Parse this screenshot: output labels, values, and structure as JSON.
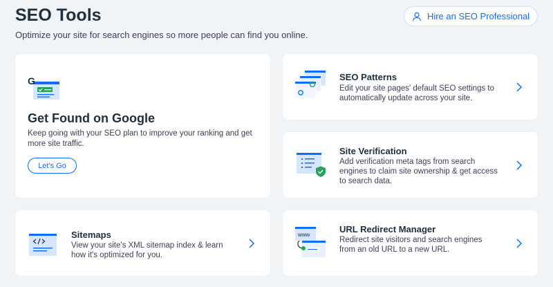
{
  "header": {
    "title": "SEO Tools",
    "subtitle": "Optimize your site for search engines so more people can find you online.",
    "hire_button": "Hire an SEO Professional"
  },
  "cards": {
    "google": {
      "icon_letter": "G",
      "title": "Get Found on Google",
      "description": "Keep going with your SEO plan to improve your ranking and get more site traffic.",
      "button": "Let's Go"
    },
    "patterns": {
      "title": "SEO Patterns",
      "description": "Edit your site pages' default SEO settings to automatically update across your site."
    },
    "verification": {
      "title": "Site Verification",
      "description": "Add verification meta tags from search engines to claim site ownership & get access to search data."
    },
    "sitemaps": {
      "title": "Sitemaps",
      "description": "View your site's XML sitemap index & learn how it's optimized for you."
    },
    "redirect": {
      "title": "URL Redirect Manager",
      "description": "Redirect site visitors and search engines from an old URL to a new URL.",
      "icon_text": "www"
    }
  },
  "colors": {
    "accent": "#116dff",
    "background": "#f0f4f7",
    "success": "#25a55a"
  },
  "icons": [
    "person-icon",
    "google-search-icon",
    "seo-patterns-icon",
    "site-verification-icon",
    "sitemap-code-icon",
    "url-redirect-icon",
    "chevron-right-icon"
  ]
}
